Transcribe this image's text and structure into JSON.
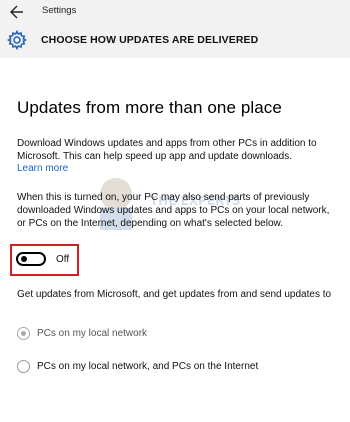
{
  "window": {
    "title": "Settings"
  },
  "header": {
    "title": "CHOOSE HOW UPDATES ARE DELIVERED"
  },
  "main": {
    "section_title": "Updates from more than one place",
    "intro": "Download Windows updates and apps from other PCs in addition to Microsoft. This can help speed up app and update downloads.",
    "learn_more": "Learn more",
    "description": "When this is turned on, your PC may also send parts of previously downloaded Windows updates and apps to PCs on your local network, or PCs on the Internet, depending on what's selected below.",
    "toggle": {
      "state_label": "Off",
      "is_on": false
    },
    "get_updates_text": "Get updates from Microsoft, and get updates from and send updates to",
    "options": [
      {
        "label": "PCs on my local network",
        "selected": true
      },
      {
        "label": "PCs on my local network, and PCs on the Internet",
        "selected": false
      }
    ]
  },
  "watermark": {
    "text": "THE EXPERTS"
  },
  "colors": {
    "header_bg": "#f2f2f2",
    "link": "#1a63c2",
    "highlight_box": "#d12020"
  }
}
